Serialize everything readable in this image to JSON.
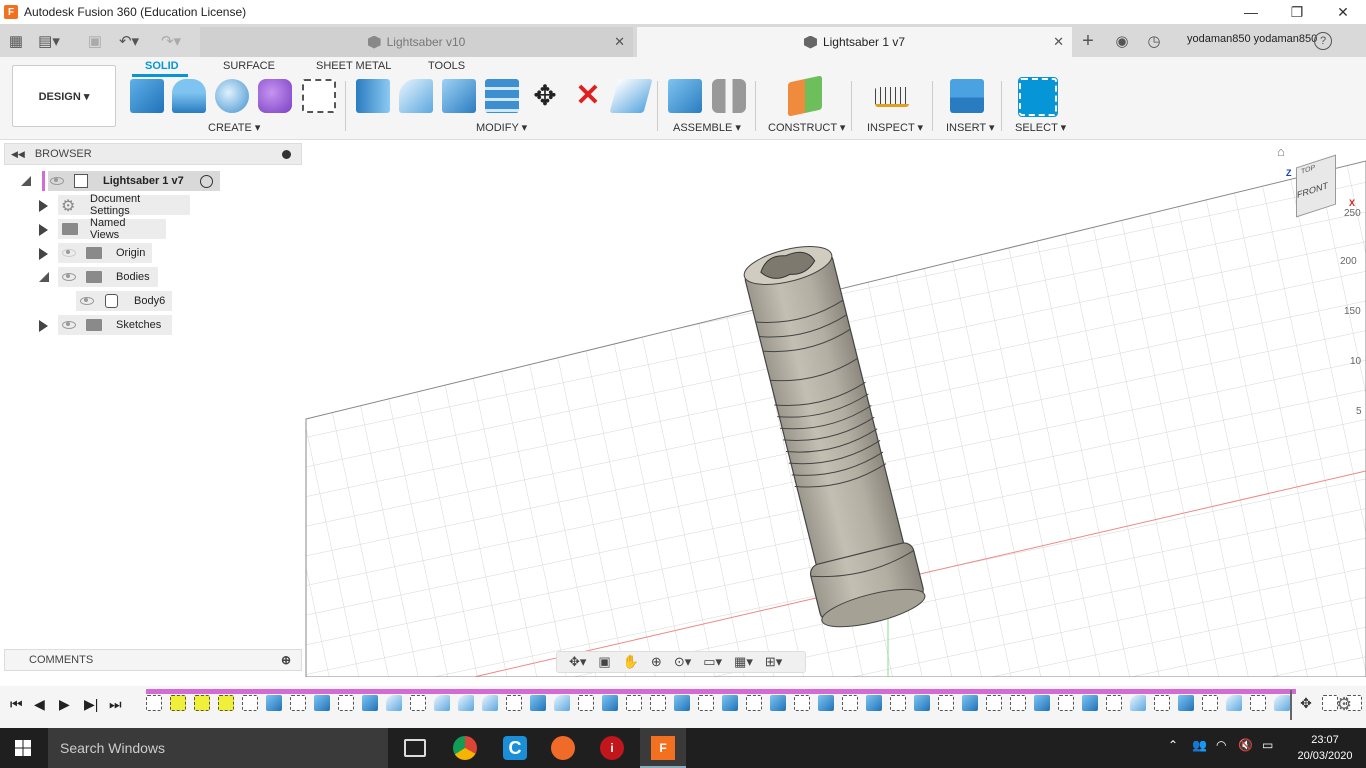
{
  "window": {
    "title": "Autodesk Fusion 360 (Education License)",
    "minimize": "—",
    "maximize": "❐",
    "close": "✕"
  },
  "tabs": [
    {
      "label": "Lightsaber v10",
      "active": false
    },
    {
      "label": "Lightsaber 1 v7",
      "active": true
    }
  ],
  "user": {
    "name": "yodaman850 yodaman850",
    "help": "?"
  },
  "toolbar": {
    "workspace": "DESIGN ▾",
    "workspace_tabs": [
      "SOLID",
      "SURFACE",
      "SHEET METAL",
      "TOOLS"
    ],
    "groups": [
      "CREATE ▾",
      "MODIFY ▾",
      "ASSEMBLE ▾",
      "CONSTRUCT ▾",
      "INSPECT ▾",
      "INSERT ▾",
      "SELECT ▾"
    ]
  },
  "browser": {
    "header": "BROWSER",
    "root": "Lightsaber 1 v7",
    "items": [
      "Document Settings",
      "Named Views",
      "Origin",
      "Bodies",
      "Body6",
      "Sketches"
    ]
  },
  "comments": {
    "header": "COMMENTS"
  },
  "viewcube": {
    "top": "TOP",
    "front": "FRONT",
    "axis_z": "Z",
    "axis_x": "X"
  },
  "ruler": [
    "250",
    "200",
    "150",
    "10",
    "5"
  ],
  "taskbar": {
    "search_placeholder": "Search Windows",
    "time": "23:07",
    "date": "20/03/2020"
  },
  "colors": {
    "accent": "#0696d7",
    "timeline": "#d46ad4",
    "body": "#b5b0a4"
  }
}
